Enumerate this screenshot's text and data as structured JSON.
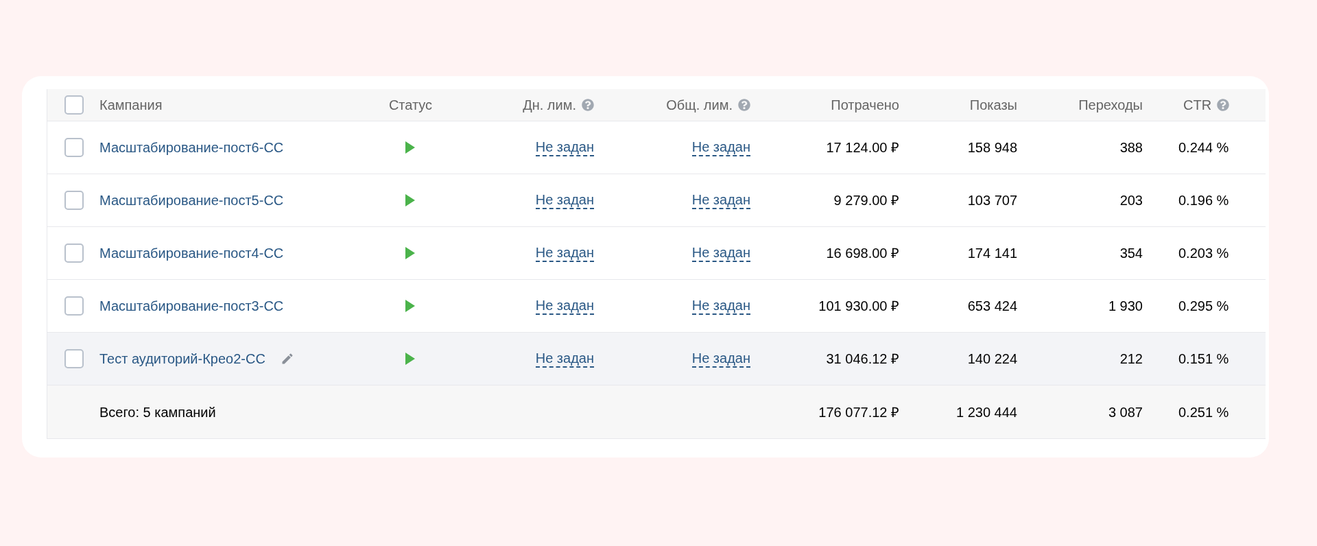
{
  "table": {
    "select_all": {
      "checked": false
    },
    "columns": [
      {
        "label": "Кампания",
        "help": false
      },
      {
        "label": "Статус",
        "help": false
      },
      {
        "label": "Дн. лим.",
        "help": true
      },
      {
        "label": "Общ. лим.",
        "help": true
      },
      {
        "label": "Потрачено",
        "help": false
      },
      {
        "label": "Показы",
        "help": false
      },
      {
        "label": "Переходы",
        "help": false
      },
      {
        "label": "CTR",
        "help": true
      }
    ],
    "rows": [
      {
        "checked": false,
        "highlighted": false,
        "editable": false,
        "name": "Масштабирование-пост6-СС",
        "running": true,
        "daily_limit": "Не задан",
        "total_limit": "Не задан",
        "spent": "17 124.00 ₽",
        "impressions": "158 948",
        "clicks": "388",
        "ctr": "0.244 %"
      },
      {
        "checked": false,
        "highlighted": false,
        "editable": false,
        "name": "Масштабирование-пост5-СС",
        "running": true,
        "daily_limit": "Не задан",
        "total_limit": "Не задан",
        "spent": "9 279.00 ₽",
        "impressions": "103 707",
        "clicks": "203",
        "ctr": "0.196 %"
      },
      {
        "checked": false,
        "highlighted": false,
        "editable": false,
        "name": "Масштабирование-пост4-СС",
        "running": true,
        "daily_limit": "Не задан",
        "total_limit": "Не задан",
        "spent": "16 698.00 ₽",
        "impressions": "174 141",
        "clicks": "354",
        "ctr": "0.203 %"
      },
      {
        "checked": false,
        "highlighted": false,
        "editable": false,
        "name": "Масштабирование-пост3-СС",
        "running": true,
        "daily_limit": "Не задан",
        "total_limit": "Не задан",
        "spent": "101 930.00 ₽",
        "impressions": "653 424",
        "clicks": "1 930",
        "ctr": "0.295 %"
      },
      {
        "checked": false,
        "highlighted": true,
        "editable": true,
        "name": "Тест аудиторий-Крео2-СС",
        "running": true,
        "daily_limit": "Не задан",
        "total_limit": "Не задан",
        "spent": "31 046.12 ₽",
        "impressions": "140 224",
        "clicks": "212",
        "ctr": "0.151 %"
      }
    ],
    "total": {
      "label": "Всего: 5 кампаний",
      "spent": "176 077.12 ₽",
      "impressions": "1 230 444",
      "clicks": "3 087",
      "ctr": "0.251 %"
    }
  }
}
